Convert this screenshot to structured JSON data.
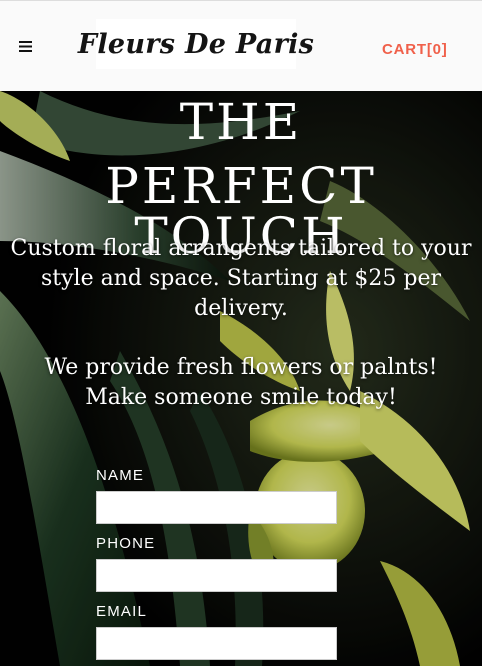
{
  "header": {
    "menu_icon": "hamburger-icon",
    "logo_text": "Fleurs De Paris",
    "cart_label": "CART[0]",
    "cart_color": "#f0604a"
  },
  "hero": {
    "title_line1": "THE",
    "title_line2": "PERFECT TOUCH",
    "description": "Custom floral arrangents tailored to your style and space. Starting at $25 per delivery.",
    "tagline": "We provide fresh flowers or palnts! Make someone smile today!"
  },
  "form": {
    "name_label": "NAME",
    "name_value": "",
    "phone_label": "PHONE",
    "phone_value": "",
    "email_label": "EMAIL",
    "email_value": ""
  }
}
